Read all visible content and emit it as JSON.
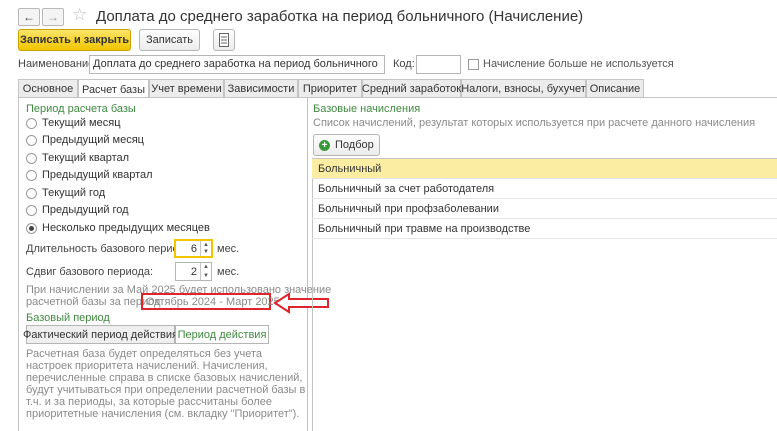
{
  "window": {
    "title": "Доплата до среднего заработка на период больничного (Начисление)"
  },
  "toolbar": {
    "save_close_label": "Записать и закрыть",
    "save_label": "Записать"
  },
  "form": {
    "name_label": "Наименование:",
    "name_value": "Доплата до среднего заработка на период больничного",
    "code_label": "Код:",
    "code_value": "",
    "not_used_label": "Начисление больше не используется"
  },
  "tabs": [
    {
      "label": "Основное"
    },
    {
      "label": "Расчет базы"
    },
    {
      "label": "Учет времени"
    },
    {
      "label": "Зависимости"
    },
    {
      "label": "Приоритет"
    },
    {
      "label": "Средний заработок"
    },
    {
      "label": "Налоги, взносы, бухучет"
    },
    {
      "label": "Описание"
    }
  ],
  "active_tab": "Расчет базы",
  "period": {
    "heading": "Период расчета базы",
    "options": [
      {
        "label": "Текущий месяц",
        "selected": false
      },
      {
        "label": "Предыдущий месяц",
        "selected": false
      },
      {
        "label": "Текущий квартал",
        "selected": false
      },
      {
        "label": "Предыдущий квартал",
        "selected": false
      },
      {
        "label": "Текущий год",
        "selected": false
      },
      {
        "label": "Предыдущий год",
        "selected": false
      },
      {
        "label": "Несколько предыдущих месяцев",
        "selected": true
      }
    ],
    "duration_label": "Длительность базового периода:",
    "duration_value": "6",
    "duration_unit": "мес.",
    "shift_label": "Сдвиг базового периода:",
    "shift_value": "2",
    "shift_unit": "мес.",
    "note_line1": "При начислении за Май 2025 будет использовано значение",
    "note_line2": "расчетной базы за период",
    "note_period": "Октябрь 2024 - Март 2025"
  },
  "base_period": {
    "heading": "Базовый период",
    "btn_actual": "Фактический период действия",
    "btn_action": "Период действия",
    "desc": "Расчетная база будет определяться без учета настроек приоритета начислений. Начисления, перечисленные справа в списке базовых начислений, будут учитываться при определении расчетной базы в т.ч. и за периоды, за которые рассчитаны более приоритетные начисления (см. вкладку \"Приоритет\")."
  },
  "base_accruals": {
    "heading": "Базовые начисления",
    "subtitle": "Список начислений, результат которых используется при расчете данного начисления",
    "pick_label": "Подбор",
    "items": [
      "Больничный",
      "Больничный за счет работодателя",
      "Больничный при профзаболевании",
      "Больничный при травме на производстве"
    ]
  },
  "colors": {
    "accent_yellow": "#f1c500",
    "green_heading": "#3f8a3f",
    "highlight_red": "#e0242b",
    "selected_row": "#fbeea2"
  }
}
